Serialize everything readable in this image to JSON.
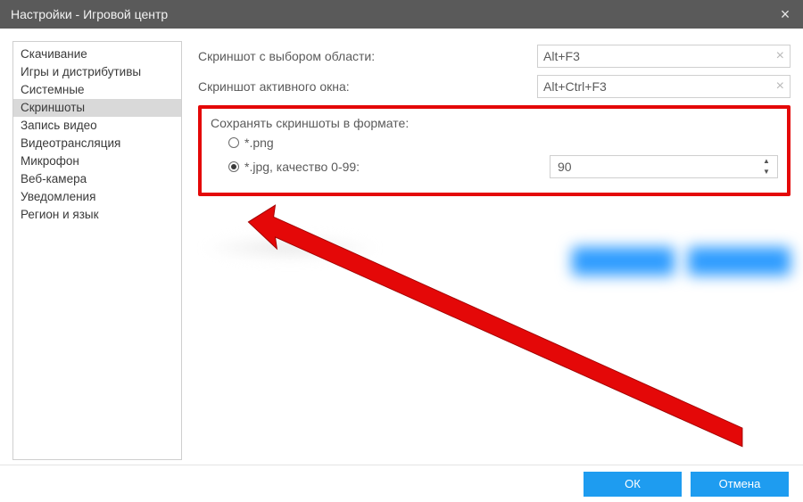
{
  "window": {
    "title": "Настройки - Игровой центр"
  },
  "sidebar": {
    "items": [
      {
        "label": "Скачивание"
      },
      {
        "label": "Игры и дистрибутивы"
      },
      {
        "label": "Системные"
      },
      {
        "label": "Скриншоты",
        "selected": true
      },
      {
        "label": "Запись видео"
      },
      {
        "label": "Видеотрансляция"
      },
      {
        "label": "Микрофон"
      },
      {
        "label": "Веб-камера"
      },
      {
        "label": "Уведомления"
      },
      {
        "label": "Регион и язык"
      }
    ]
  },
  "fields": {
    "area_label": "Скриншот с выбором области:",
    "area_value": "Alt+F3",
    "active_label": "Скриншот активного окна:",
    "active_value": "Alt+Ctrl+F3"
  },
  "format": {
    "section_label": "Сохранять скриншоты в формате:",
    "png_label": "*.png",
    "jpg_label": "*.jpg, качество 0-99:",
    "quality_value": "90"
  },
  "footer": {
    "ok": "ОК",
    "cancel": "Отмена"
  }
}
